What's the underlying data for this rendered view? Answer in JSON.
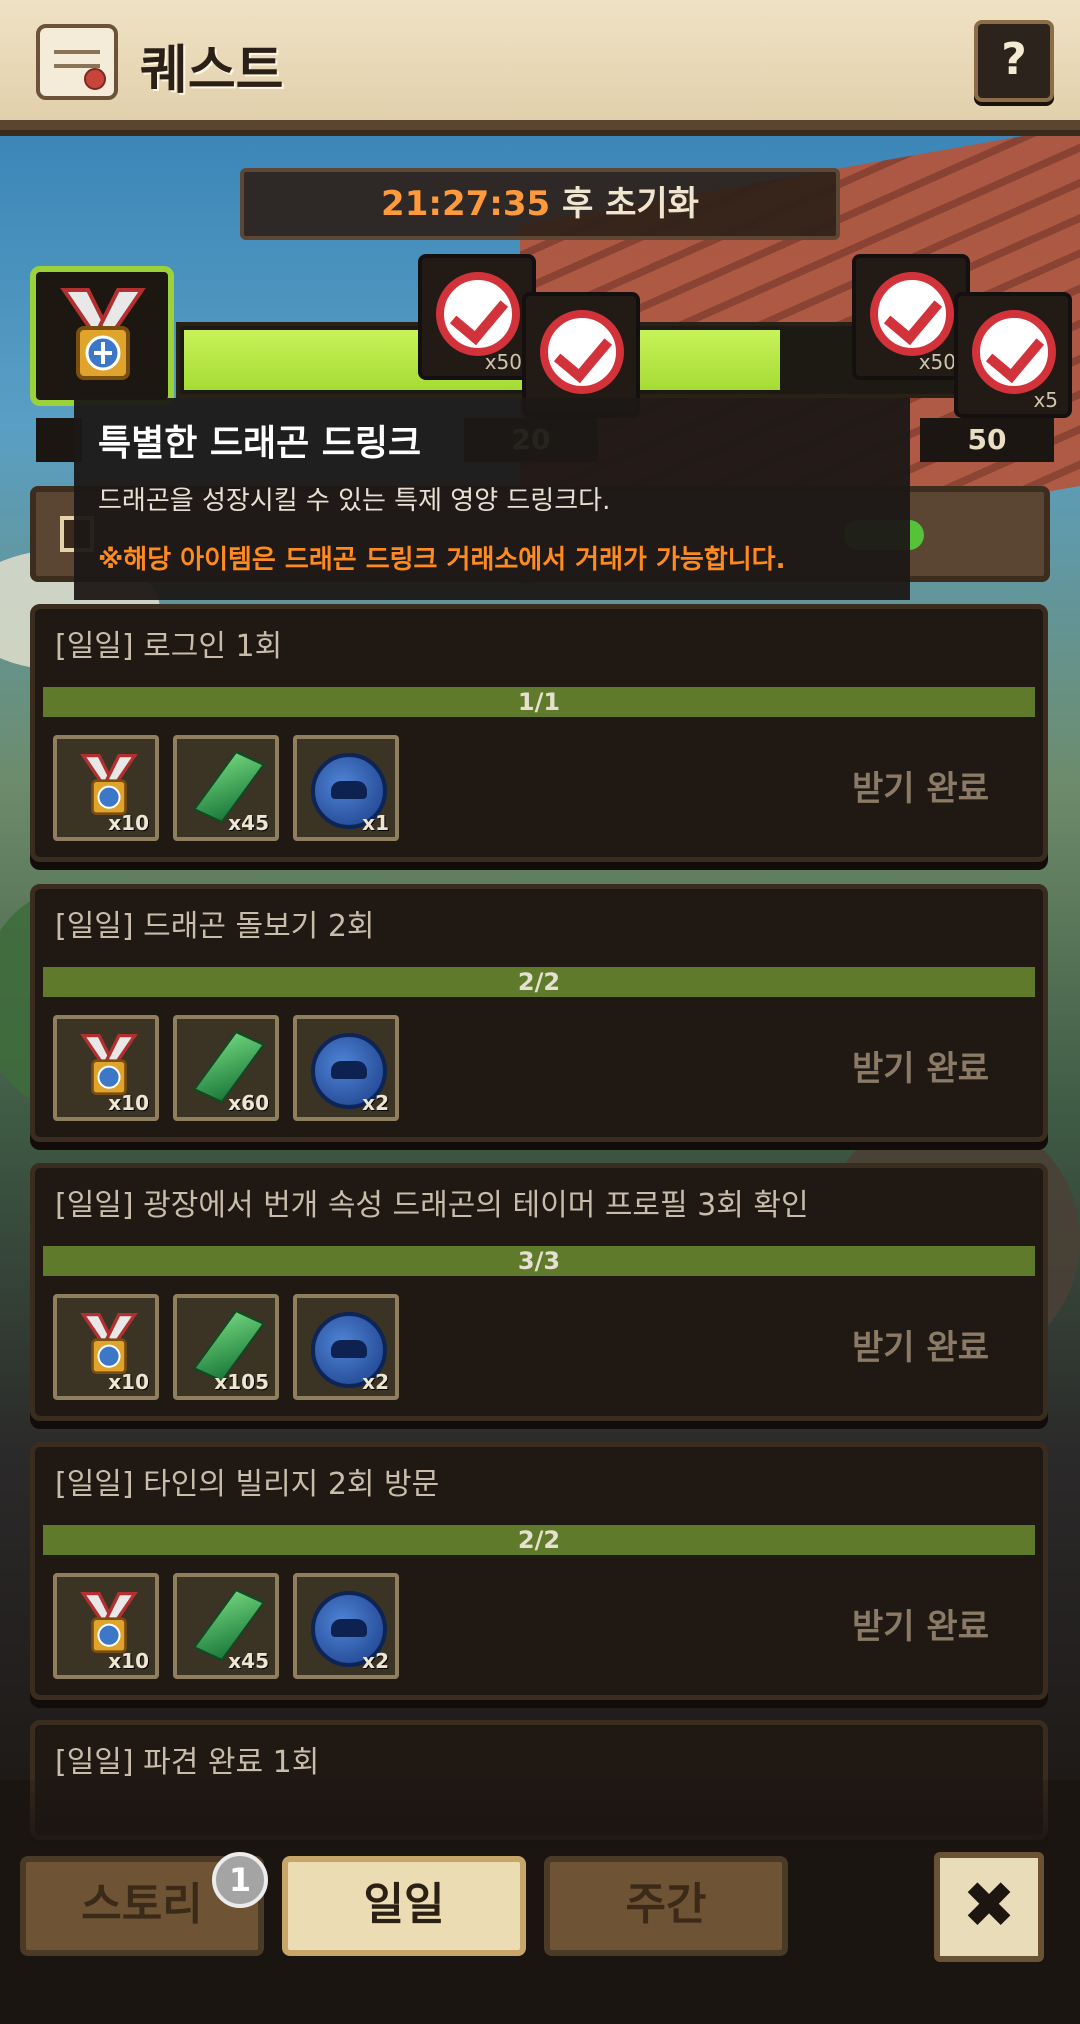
{
  "header": {
    "title": "퀘스트",
    "help_label": "?",
    "scroll_icon": "scroll-icon"
  },
  "timer": {
    "time": "21:27:35",
    "suffix": " 후 초기화"
  },
  "progress": {
    "fill_fraction": 0.7,
    "marks": [
      "20",
      "50"
    ],
    "milestones": [
      {
        "qty": "x50",
        "claimed": true
      },
      {
        "qty": "",
        "claimed": true
      },
      {
        "qty": "x50",
        "claimed": true
      },
      {
        "qty": "x5",
        "claimed": true
      }
    ]
  },
  "tooltip": {
    "title": "특별한 드래곤 드링크",
    "description": "드래곤을 성장시킬 수 있는 특제 영양 드링크다.",
    "note": "※해당 아이템은 드래곤 드링크 거래소에서 거래가 가능합니다."
  },
  "quests": [
    {
      "title": "[일일] 로그인 1회",
      "progress": "1/1",
      "rewards": [
        {
          "icon": "medal-icon",
          "qty": "x10"
        },
        {
          "icon": "gem-icon",
          "qty": "x45"
        },
        {
          "icon": "coin-icon",
          "qty": "x1"
        }
      ],
      "status": "받기 완료"
    },
    {
      "title": "[일일] 드래곤 돌보기 2회",
      "progress": "2/2",
      "rewards": [
        {
          "icon": "medal-icon",
          "qty": "x10"
        },
        {
          "icon": "gem-icon",
          "qty": "x60"
        },
        {
          "icon": "coin-icon",
          "qty": "x2"
        }
      ],
      "status": "받기 완료"
    },
    {
      "title": "[일일] 광장에서 번개 속성 드래곤의 테이머 프로필 3회 확인",
      "progress": "3/3",
      "rewards": [
        {
          "icon": "medal-icon",
          "qty": "x10"
        },
        {
          "icon": "gem-icon",
          "qty": "x105"
        },
        {
          "icon": "coin-icon",
          "qty": "x2"
        }
      ],
      "status": "받기 완료"
    },
    {
      "title": "[일일] 타인의 빌리지 2회 방문",
      "progress": "2/2",
      "rewards": [
        {
          "icon": "medal-icon",
          "qty": "x10"
        },
        {
          "icon": "gem-icon",
          "qty": "x45"
        },
        {
          "icon": "coin-icon",
          "qty": "x2"
        }
      ],
      "status": "받기 완료"
    },
    {
      "title": "[일일] 파견 완료 1회"
    }
  ],
  "tabs": {
    "story": "스토리",
    "daily": "일일",
    "weekly": "주간",
    "badge": "1",
    "close": "✖"
  }
}
